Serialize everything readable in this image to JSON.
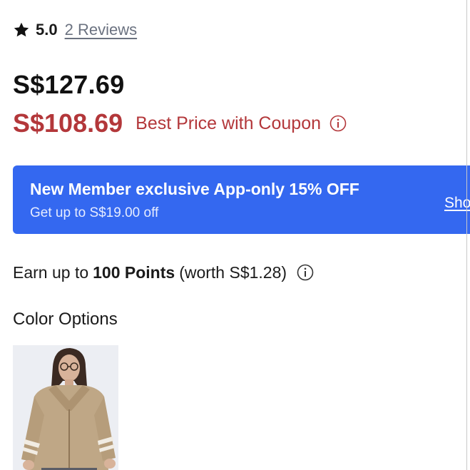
{
  "rating": {
    "star_icon": "star-icon",
    "value": "5.0",
    "reviews_link": "2 Reviews"
  },
  "pricing": {
    "original_price": "S$127.69",
    "coupon_price": "S$108.69",
    "coupon_label": "Best Price with Coupon",
    "info_icon": "info-icon",
    "price_color": "#b3373a"
  },
  "promo_banner": {
    "title": "New Member exclusive App-only 15% OFF",
    "subtitle": "Get up to S$19.00 off",
    "link_label": "Sho",
    "background_color": "#3468f0"
  },
  "points": {
    "prefix": "Earn up to",
    "amount": "100 Points",
    "suffix": "(worth S$1.28)",
    "info_icon": "info-icon"
  },
  "color_options": {
    "heading": "Color Options",
    "swatches": [
      {
        "name": "beige-zip-jacket"
      }
    ]
  }
}
